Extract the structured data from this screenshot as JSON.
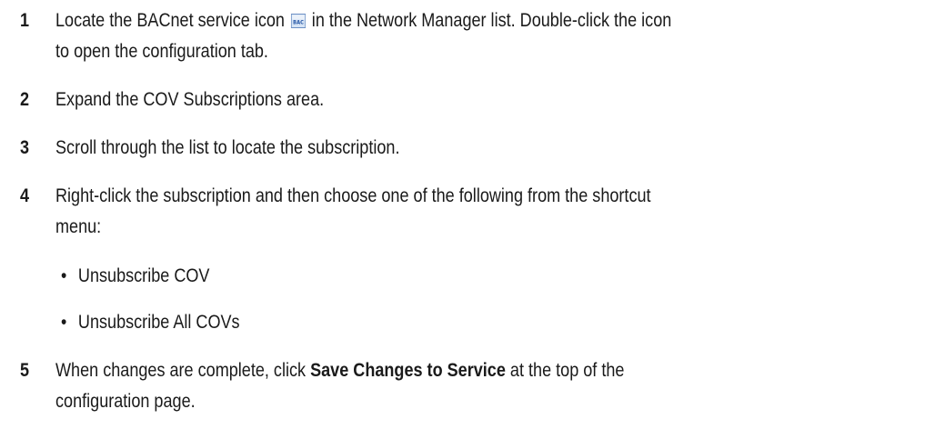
{
  "steps": [
    {
      "number": "1",
      "line1_before_icon": "Locate the BACnet service icon",
      "icon_name": "bacnet-service-icon",
      "icon_label": "BAC",
      "line1_after_icon": "in the Network Manager list. Double-click the icon",
      "line2": "to open the configuration tab."
    },
    {
      "number": "2",
      "line1": "Expand the COV Subscriptions area."
    },
    {
      "number": "3",
      "line1": "Scroll through the list to locate the subscription."
    },
    {
      "number": "4",
      "line1": "Right-click the subscription and then choose one of the following from the shortcut",
      "line2": "menu:",
      "bullets": [
        "Unsubscribe COV",
        "Unsubscribe All COVs"
      ]
    },
    {
      "number": "5",
      "line1_before_bold": "When changes are complete, click",
      "bold_text": "Save Changes to Service",
      "line1_after_bold": "at the top of the",
      "line2": "configuration page."
    }
  ],
  "colors": {
    "text": "#1a1a1a",
    "icon_bg": "#d6e4f5",
    "icon_border": "#6b8fc4",
    "icon_text": "#2a5aa8"
  }
}
